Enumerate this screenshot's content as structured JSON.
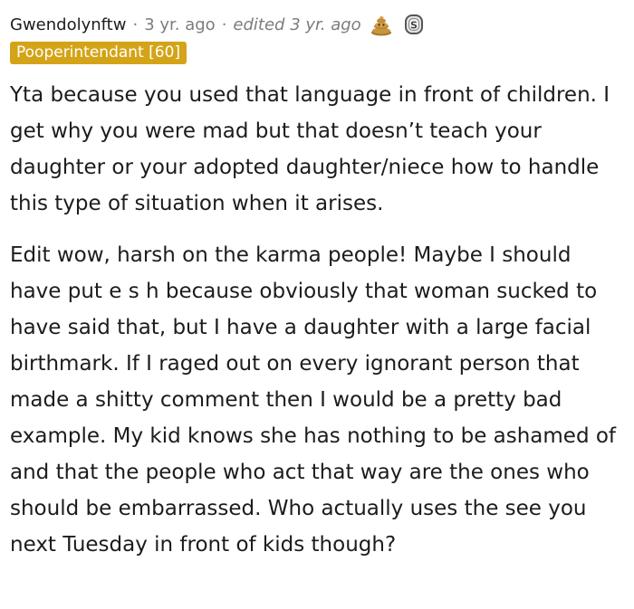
{
  "comment": {
    "author": "Gwendolynftw",
    "separator": "·",
    "timestamp": "3 yr. ago",
    "edited": "edited 3 yr. ago",
    "awards": [
      {
        "icon": "poop-award-icon",
        "color": "#c8963c"
      },
      {
        "icon": "silver-coin-award-icon",
        "color": "#8a8a8a"
      }
    ],
    "flair": {
      "text": "Pooperintendant [60]",
      "background": "#d4a418",
      "text_color": "#ffffff"
    },
    "paragraphs": [
      "Yta because you used that language in front of children. I get why you were mad but that doesn’t teach your daughter or your adopted daughter/niece how to handle this type of situation when it arises.",
      "Edit wow, harsh on the karma people! Maybe I should have put e s h because obviously that woman sucked to have said that, but I have a daughter with a large facial birthmark. If I raged out on every ignorant person that made a shitty comment then I would be a pretty bad example. My kid knows she has nothing to be ashamed of and that the people who act that way are the ones who should be embarrassed. Who actually uses the see you next Tuesday in front of kids though?"
    ]
  }
}
